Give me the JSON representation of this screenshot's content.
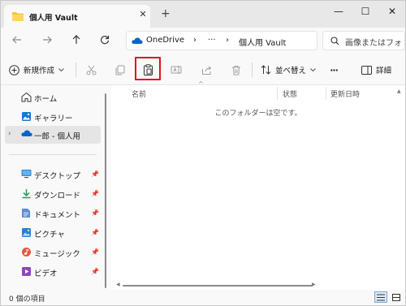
{
  "tab": {
    "title": "個人用 Vault",
    "close": "✕",
    "new_tab": "+"
  },
  "window_controls": {
    "minimize": "—",
    "maximize": "☐",
    "close": "✕"
  },
  "address": {
    "crumbs": [
      "OneDrive",
      "›",
      "···",
      "›",
      "個人用 Vault"
    ],
    "search_placeholder": "画像またはフォ"
  },
  "command_bar": {
    "new_label": "新規作成",
    "sort_label": "並べ替え",
    "more_label": "···",
    "details_label": "詳細",
    "highlighted_command": "paste"
  },
  "sidebar": {
    "items": [
      {
        "label": "ホーム",
        "icon": "home-icon"
      },
      {
        "label": "ギャラリー",
        "icon": "gallery-icon"
      },
      {
        "label": "一郎 - 個人用",
        "icon": "onedrive-icon",
        "selected": true
      }
    ],
    "quick_access": [
      {
        "label": "デスクトップ",
        "icon": "desktop-icon",
        "pinned": true
      },
      {
        "label": "ダウンロード",
        "icon": "download-icon",
        "pinned": true
      },
      {
        "label": "ドキュメント",
        "icon": "document-icon",
        "pinned": true
      },
      {
        "label": "ピクチャ",
        "icon": "picture-icon",
        "pinned": true
      },
      {
        "label": "ミュージック",
        "icon": "music-icon",
        "pinned": true
      },
      {
        "label": "ビデオ",
        "icon": "video-icon",
        "pinned": true
      }
    ]
  },
  "content": {
    "columns": [
      "名前",
      "状態",
      "更新日時"
    ],
    "empty_message": "このフォルダーは空です。"
  },
  "status": {
    "item_count": "0 個の項目"
  },
  "colors": {
    "highlight": "#e0101a",
    "accent": "#0067c0",
    "folder": "#f6c343"
  }
}
